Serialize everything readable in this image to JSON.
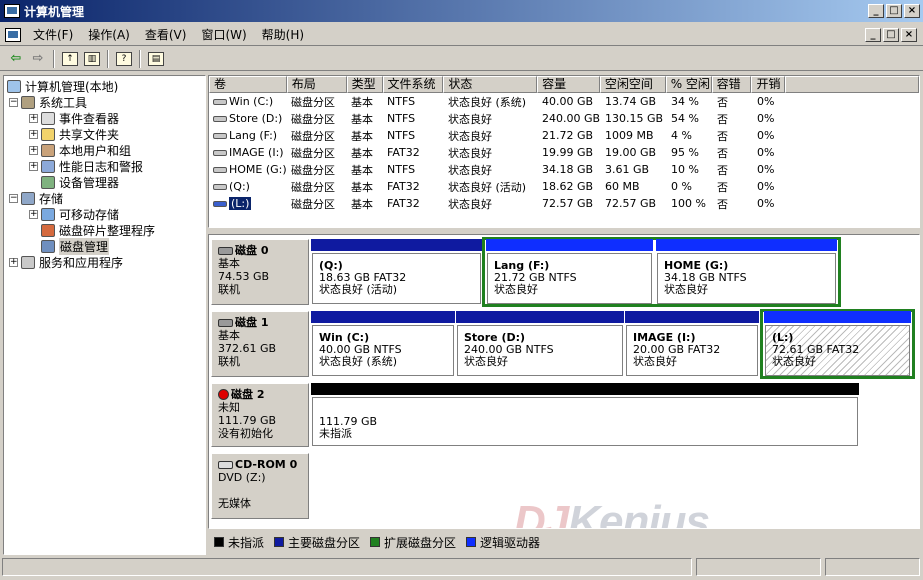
{
  "window": {
    "title": "计算机管理",
    "min": "_",
    "max": "□",
    "close": "×"
  },
  "menu": {
    "items": [
      "文件(F)",
      "操作(A)",
      "查看(V)",
      "窗口(W)",
      "帮助(H)"
    ]
  },
  "tree": {
    "root": "计算机管理(本地)",
    "system_tools": "系统工具",
    "event_viewer": "事件查看器",
    "shared_folders": "共享文件夹",
    "local_users": "本地用户和组",
    "perf_logs": "性能日志和警报",
    "device_manager": "设备管理器",
    "storage": "存储",
    "removable": "可移动存储",
    "defrag": "磁盘碎片整理程序",
    "disk_mgmt": "磁盘管理",
    "services": "服务和应用程序"
  },
  "volume_list": {
    "headers": [
      "卷",
      "布局",
      "类型",
      "文件系统",
      "状态",
      "容量",
      "空闲空间",
      "% 空闲",
      "容错",
      "开销"
    ],
    "rows": [
      [
        "Win (C:)",
        "磁盘分区",
        "基本",
        "NTFS",
        "状态良好 (系统)",
        "40.00 GB",
        "13.74 GB",
        "34 %",
        "否",
        "0%"
      ],
      [
        "Store (D:)",
        "磁盘分区",
        "基本",
        "NTFS",
        "状态良好",
        "240.00 GB",
        "130.15 GB",
        "54 %",
        "否",
        "0%"
      ],
      [
        "Lang (F:)",
        "磁盘分区",
        "基本",
        "NTFS",
        "状态良好",
        "21.72 GB",
        "1009 MB",
        "4 %",
        "否",
        "0%"
      ],
      [
        "IMAGE (I:)",
        "磁盘分区",
        "基本",
        "FAT32",
        "状态良好",
        "19.99 GB",
        "19.00 GB",
        "95 %",
        "否",
        "0%"
      ],
      [
        "HOME (G:)",
        "磁盘分区",
        "基本",
        "NTFS",
        "状态良好",
        "34.18 GB",
        "3.61 GB",
        "10 %",
        "否",
        "0%"
      ],
      [
        "(Q:)",
        "磁盘分区",
        "基本",
        "FAT32",
        "状态良好 (活动)",
        "18.62 GB",
        "60 MB",
        "0 %",
        "否",
        "0%"
      ],
      [
        "(L:)",
        "磁盘分区",
        "基本",
        "FAT32",
        "状态良好",
        "72.57 GB",
        "72.57 GB",
        "100 %",
        "否",
        "0%"
      ]
    ]
  },
  "disks": {
    "d0": {
      "name": "磁盘 0",
      "type": "基本",
      "size": "74.53 GB",
      "status": "联机"
    },
    "d1": {
      "name": "磁盘 1",
      "type": "基本",
      "size": "372.61 GB",
      "status": "联机"
    },
    "d2": {
      "name": "磁盘 2",
      "type": "未知",
      "size": "111.79 GB",
      "status": "没有初始化"
    },
    "cd": {
      "name": "CD-ROM 0",
      "type": "DVD (Z:)",
      "status": "无媒体"
    }
  },
  "partitions": {
    "q": {
      "name": "(Q:)",
      "info": "18.63 GB FAT32",
      "status": "状态良好 (活动)"
    },
    "f": {
      "name": "Lang  (F:)",
      "info": "21.72 GB NTFS",
      "status": "状态良好"
    },
    "g": {
      "name": "HOME  (G:)",
      "info": "34.18 GB NTFS",
      "status": "状态良好"
    },
    "c": {
      "name": "Win  (C:)",
      "info": "40.00 GB NTFS",
      "status": "状态良好 (系统)"
    },
    "d": {
      "name": "Store  (D:)",
      "info": "240.00 GB NTFS",
      "status": "状态良好"
    },
    "i": {
      "name": "IMAGE  (I:)",
      "info": "20.00 GB FAT32",
      "status": "状态良好"
    },
    "l": {
      "name": "(L:)",
      "info": "72.61 GB FAT32",
      "status": "状态良好"
    },
    "unalloc": {
      "info": "111.79 GB",
      "status": "未指派"
    }
  },
  "legend": {
    "items": [
      {
        "label": "未指派",
        "color": "#000000"
      },
      {
        "label": "主要磁盘分区",
        "color": "#0f1aa0"
      },
      {
        "label": "扩展磁盘分区",
        "color": "#208020"
      },
      {
        "label": "逻辑驱动器",
        "color": "#0f2eff"
      }
    ]
  },
  "watermark": {
    "text1": "DJ",
    "text2": "Kenius"
  }
}
